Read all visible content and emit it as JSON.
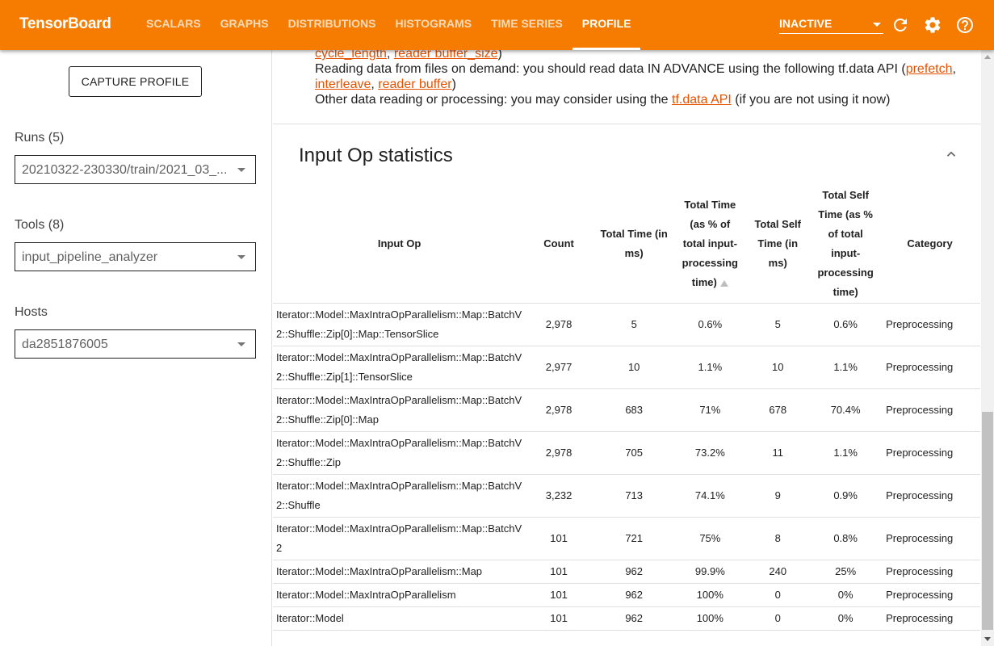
{
  "app": {
    "title": "TensorBoard"
  },
  "nav": {
    "tabs": [
      "SCALARS",
      "GRAPHS",
      "DISTRIBUTIONS",
      "HISTOGRAMS",
      "TIME SERIES",
      "PROFILE"
    ],
    "active": "PROFILE"
  },
  "header": {
    "status": "INACTIVE",
    "icons": [
      "refresh-icon",
      "settings-icon",
      "help-icon"
    ]
  },
  "sidebar": {
    "capture_label": "CAPTURE PROFILE",
    "runs_label": "Runs (5)",
    "runs_value": "20210322-230330/train/2021_03_...",
    "tools_label": "Tools (8)",
    "tools_value": "input_pipeline_analyzer",
    "hosts_label": "Hosts",
    "hosts_value": "da2851876005"
  },
  "advice": {
    "line1_links": [
      "cycle_length",
      "reader buffer_size"
    ],
    "line1_sep": ", ",
    "line1_end": ")",
    "line2_text": "Reading data from files on demand: you should read data IN ADVANCE using the following tf.data API (",
    "line2_links": [
      "prefetch",
      "interleave",
      "reader buffer"
    ],
    "line2_end": ")",
    "line3_text": "Other data reading or processing: you may consider using the ",
    "line3_link": "tf.data API",
    "line3_end": " (if you are not using it now)"
  },
  "section": {
    "title": "Input Op statistics",
    "collapse_icon": "chevron-up-icon"
  },
  "table": {
    "headers": [
      "Input Op",
      "Count",
      "Total Time (in ms)",
      "Total Time (as % of total input-processing time)",
      "Total Self Time (in ms)",
      "Total Self Time (as % of total input-processing time)",
      "Category"
    ],
    "sorted_column": 3,
    "rows": [
      [
        "Iterator::Model::MaxIntraOpParallelism::Map::BatchV2::Shuffle::Zip[0]::Map::TensorSlice",
        "2,978",
        "5",
        "0.6%",
        "5",
        "0.6%",
        "Preprocessing"
      ],
      [
        "Iterator::Model::MaxIntraOpParallelism::Map::BatchV2::Shuffle::Zip[1]::TensorSlice",
        "2,977",
        "10",
        "1.1%",
        "10",
        "1.1%",
        "Preprocessing"
      ],
      [
        "Iterator::Model::MaxIntraOpParallelism::Map::BatchV2::Shuffle::Zip[0]::Map",
        "2,978",
        "683",
        "71%",
        "678",
        "70.4%",
        "Preprocessing"
      ],
      [
        "Iterator::Model::MaxIntraOpParallelism::Map::BatchV2::Shuffle::Zip",
        "2,978",
        "705",
        "73.2%",
        "11",
        "1.1%",
        "Preprocessing"
      ],
      [
        "Iterator::Model::MaxIntraOpParallelism::Map::BatchV2::Shuffle",
        "3,232",
        "713",
        "74.1%",
        "9",
        "0.9%",
        "Preprocessing"
      ],
      [
        "Iterator::Model::MaxIntraOpParallelism::Map::BatchV2",
        "101",
        "721",
        "75%",
        "8",
        "0.8%",
        "Preprocessing"
      ],
      [
        "Iterator::Model::MaxIntraOpParallelism::Map",
        "101",
        "962",
        "99.9%",
        "240",
        "25%",
        "Preprocessing"
      ],
      [
        "Iterator::Model::MaxIntraOpParallelism",
        "101",
        "962",
        "100%",
        "0",
        "0%",
        "Preprocessing"
      ],
      [
        "Iterator::Model",
        "101",
        "962",
        "100%",
        "0",
        "0%",
        "Preprocessing"
      ]
    ]
  },
  "colors": {
    "accent": "#f57c00",
    "link": "#e65100"
  }
}
